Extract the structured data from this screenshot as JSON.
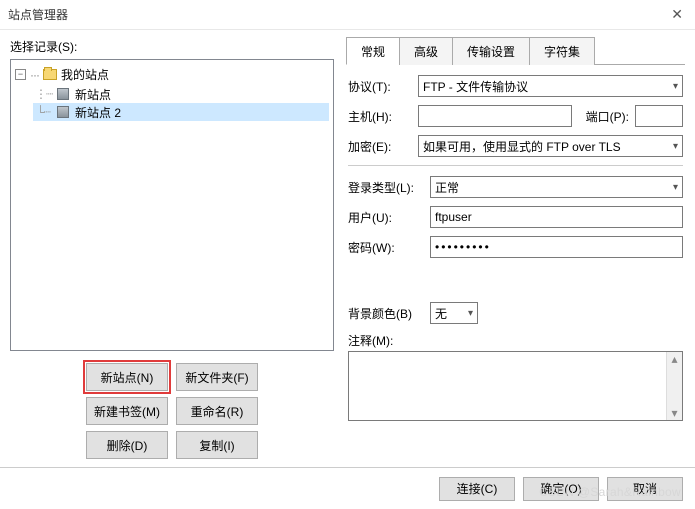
{
  "window": {
    "title": "站点管理器"
  },
  "left": {
    "select_label": "选择记录(S):",
    "root_label": "我的站点",
    "items": [
      {
        "label": "新站点",
        "selected": false
      },
      {
        "label": "新站点 2",
        "selected": true
      }
    ],
    "buttons": {
      "new_site": "新站点(N)",
      "new_folder": "新文件夹(F)",
      "new_bookmark": "新建书签(M)",
      "rename": "重命名(R)",
      "delete": "删除(D)",
      "copy": "复制(I)"
    }
  },
  "tabs": {
    "general": "常规",
    "advanced": "高级",
    "transfer": "传输设置",
    "charset": "字符集"
  },
  "form": {
    "protocol_label": "协议(T):",
    "protocol_value": "FTP - 文件传输协议",
    "host_label": "主机(H):",
    "host_value": "",
    "port_label": "端口(P):",
    "port_value": "",
    "encryption_label": "加密(E):",
    "encryption_value": "如果可用，使用显式的 FTP over TLS",
    "logon_label": "登录类型(L):",
    "logon_value": "正常",
    "user_label": "用户(U):",
    "user_value": "ftpuser",
    "pass_label": "密码(W):",
    "pass_value": "•••••••••",
    "bg_label": "背景颜色(B)",
    "bg_value": "无",
    "comment_label": "注释(M):"
  },
  "bottom": {
    "connect": "连接(C)",
    "ok": "确定(O)",
    "cancel": "取消"
  },
  "watermark": "CSDN @Sarah&Rainbow"
}
